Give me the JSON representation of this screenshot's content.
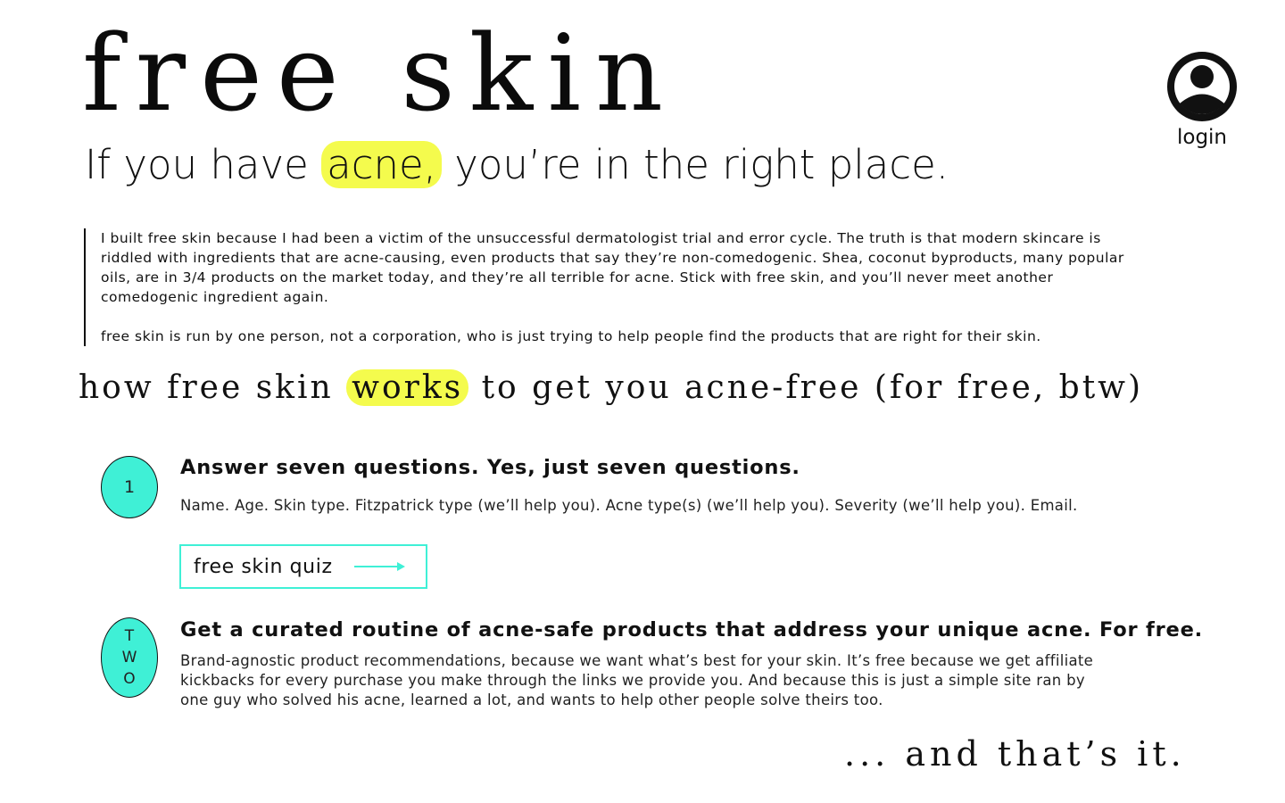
{
  "brand": {
    "title": "free skin"
  },
  "header": {
    "login_label": "login",
    "login_icon": "user-circle-icon"
  },
  "hero": {
    "tagline_before": "If you have ",
    "tagline_highlight": "acne,",
    "tagline_after": " you’re in the right place.",
    "highlight_color": "#f4fb4d"
  },
  "intro": {
    "paragraph_1": "I built free skin because I had been a victim of the unsuccessful dermatologist trial and error cycle. The truth is that modern skincare is riddled with ingredients that are acne-causing, even products that say they’re non-comedogenic. Shea, coconut byproducts, many popular oils, are in 3/4 products on the market today, and they’re all terrible for acne. Stick with free skin, and you’ll never meet another comedogenic ingredient again.",
    "paragraph_2": "free skin is run by one person, not a corporation, who is just trying to help people find the products that are right for their skin."
  },
  "how": {
    "before": "how free skin ",
    "highlight": "works",
    "after": " to get you acne-free (for free, btw)"
  },
  "steps": [
    {
      "badge": "1",
      "title": "Answer seven questions. Yes, just seven questions.",
      "description": "Name. Age. Skin type. Fitzpatrick type (we’ll help you). Acne type(s) (we’ll help you). Severity (we’ll help you). Email."
    },
    {
      "badge_letters": [
        "T",
        "W",
        "O"
      ],
      "title": "Get a curated routine of acne-safe products that address your unique acne. For free.",
      "description": "Brand-agnostic product recommendations, because we want what’s best for your skin. It’s free because we get affiliate kickbacks for every purchase you make through the links we provide you. And because this is just a simple site ran by one guy who solved his acne, learned a lot, and wants to help other people solve theirs too."
    }
  ],
  "quiz_button": {
    "label": "free skin quiz",
    "icon": "arrow-right-icon",
    "accent_color": "#3ff0d6"
  },
  "outro": {
    "text": "... and that’s it."
  }
}
